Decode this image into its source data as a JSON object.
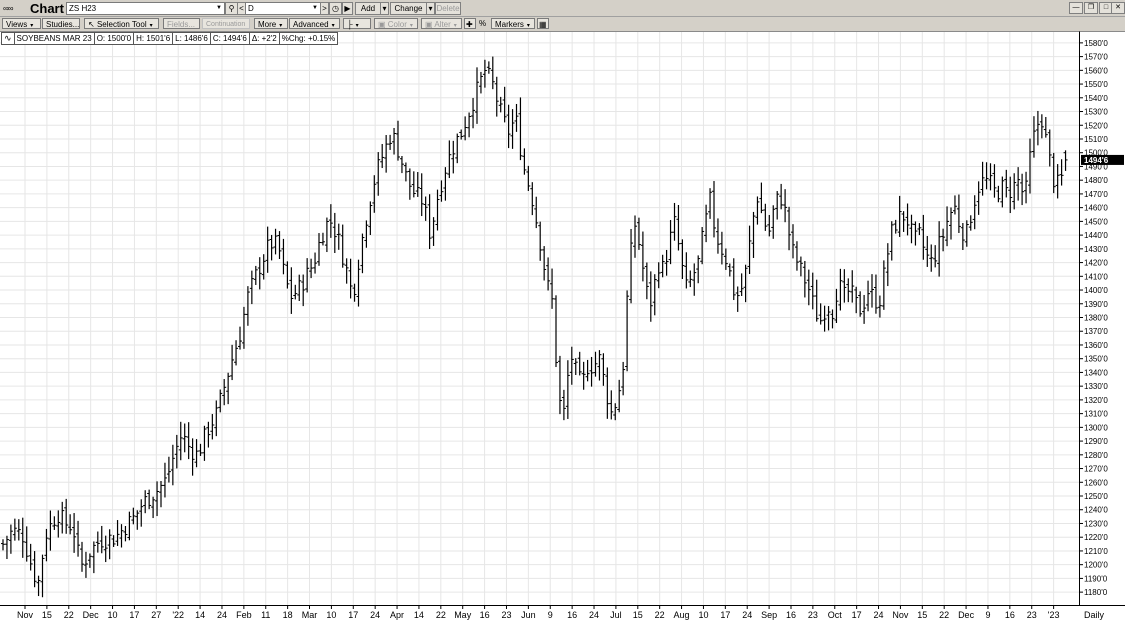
{
  "window": {
    "title": "Chart",
    "symbol_input": "ZS H23",
    "period_input": "D",
    "add_label": "Add",
    "change_label": "Change",
    "delete_label": "Delete"
  },
  "toolbar": {
    "views": "Views",
    "studies": "Studies...",
    "selection_tool": "Selection Tool",
    "fields": "Fields...",
    "continuation": "Continuation",
    "more": "More",
    "advanced": "Advanced",
    "color": "Color",
    "alter": "Alter",
    "percent": "%",
    "markers": "Markers"
  },
  "info": {
    "name": "SOYBEANS MAR 23",
    "open": "O: 1500'0",
    "high": "H: 1501'6",
    "low": "L: 1486'6",
    "close": "C: 1494'6",
    "delta": "Δ: +2'2",
    "pct": "%Chg: +0.15%"
  },
  "last_price_label": "1494'6",
  "period_label": "Daily",
  "colors": {
    "bars": "#000000",
    "grid": "#e6e6e6",
    "last_price_bg": "#000000"
  },
  "chart_data": {
    "type": "ohlc",
    "title": "SOYBEANS MAR 23",
    "grid": true,
    "ylim": [
      1175,
      1585
    ],
    "y_ticks": [
      "1180'0",
      "1190'0",
      "1200'0",
      "1210'0",
      "1220'0",
      "1230'0",
      "1240'0",
      "1250'0",
      "1260'0",
      "1270'0",
      "1280'0",
      "1290'0",
      "1300'0",
      "1310'0",
      "1320'0",
      "1330'0",
      "1340'0",
      "1350'0",
      "1360'0",
      "1370'0",
      "1380'0",
      "1390'0",
      "1400'0",
      "1410'0",
      "1420'0",
      "1430'0",
      "1440'0",
      "1450'0",
      "1460'0",
      "1470'0",
      "1480'0",
      "1490'0",
      "1500'0",
      "1510'0",
      "1520'0",
      "1530'0",
      "1540'0",
      "1550'0",
      "1560'0",
      "1570'0",
      "1580'0"
    ],
    "x_ticks": [
      "Nov",
      "15",
      "22",
      "Dec",
      "10",
      "17",
      "27",
      "'22",
      "14",
      "24",
      "Feb",
      "11",
      "18",
      "Mar",
      "10",
      "17",
      "24",
      "Apr",
      "14",
      "22",
      "May",
      "16",
      "23",
      "Jun",
      "9",
      "16",
      "24",
      "Jul",
      "15",
      "22",
      "Aug",
      "10",
      "17",
      "24",
      "Sep",
      "16",
      "23",
      "Oct",
      "17",
      "24",
      "Nov",
      "15",
      "22",
      "Dec",
      "9",
      "16",
      "23",
      "'23"
    ],
    "close_path": [
      [
        0,
        1215
      ],
      [
        5,
        1225
      ],
      [
        10,
        1222
      ],
      [
        15,
        1198
      ],
      [
        18,
        1185
      ],
      [
        22,
        1222
      ],
      [
        28,
        1238
      ],
      [
        32,
        1230
      ],
      [
        36,
        1228
      ],
      [
        40,
        1198
      ],
      [
        45,
        1210
      ],
      [
        50,
        1218
      ],
      [
        58,
        1220
      ],
      [
        63,
        1228
      ],
      [
        68,
        1235
      ],
      [
        72,
        1245
      ],
      [
        76,
        1250
      ],
      [
        80,
        1255
      ],
      [
        84,
        1262
      ],
      [
        88,
        1280
      ],
      [
        92,
        1295
      ],
      [
        96,
        1285
      ],
      [
        100,
        1280
      ],
      [
        106,
        1300
      ],
      [
        110,
        1310
      ],
      [
        114,
        1330
      ],
      [
        118,
        1350
      ],
      [
        122,
        1368
      ],
      [
        126,
        1395
      ],
      [
        130,
        1410
      ],
      [
        133,
        1420
      ],
      [
        136,
        1430
      ],
      [
        139,
        1435
      ],
      [
        142,
        1430
      ],
      [
        145,
        1410
      ],
      [
        148,
        1395
      ],
      [
        152,
        1400
      ],
      [
        156,
        1410
      ],
      [
        160,
        1420
      ],
      [
        164,
        1440
      ],
      [
        168,
        1452
      ],
      [
        172,
        1440
      ],
      [
        176,
        1420
      ],
      [
        180,
        1395
      ],
      [
        184,
        1430
      ],
      [
        188,
        1460
      ],
      [
        192,
        1485
      ],
      [
        196,
        1500
      ],
      [
        200,
        1515
      ],
      [
        204,
        1500
      ],
      [
        208,
        1480
      ],
      [
        212,
        1470
      ],
      [
        216,
        1465
      ],
      [
        220,
        1440
      ],
      [
        224,
        1470
      ],
      [
        228,
        1490
      ],
      [
        232,
        1505
      ],
      [
        236,
        1515
      ],
      [
        240,
        1530
      ],
      [
        244,
        1545
      ],
      [
        248,
        1560
      ],
      [
        252,
        1550
      ],
      [
        256,
        1530
      ],
      [
        260,
        1515
      ],
      [
        264,
        1525
      ],
      [
        268,
        1490
      ],
      [
        272,
        1470
      ],
      [
        276,
        1440
      ],
      [
        280,
        1405
      ],
      [
        283,
        1390
      ],
      [
        286,
        1320
      ],
      [
        289,
        1310
      ],
      [
        292,
        1355
      ],
      [
        295,
        1340
      ],
      [
        298,
        1330
      ],
      [
        301,
        1345
      ],
      [
        304,
        1345
      ],
      [
        307,
        1350
      ],
      [
        310,
        1330
      ],
      [
        313,
        1310
      ],
      [
        316,
        1320
      ],
      [
        319,
        1340
      ],
      [
        322,
        1410
      ],
      [
        325,
        1450
      ],
      [
        328,
        1430
      ],
      [
        331,
        1400
      ],
      [
        334,
        1390
      ],
      [
        337,
        1420
      ],
      [
        340,
        1415
      ],
      [
        343,
        1435
      ],
      [
        346,
        1450
      ],
      [
        349,
        1420
      ],
      [
        352,
        1400
      ],
      [
        355,
        1410
      ],
      [
        358,
        1420
      ],
      [
        361,
        1445
      ],
      [
        364,
        1465
      ],
      [
        367,
        1440
      ],
      [
        370,
        1430
      ],
      [
        373,
        1420
      ],
      [
        376,
        1400
      ],
      [
        379,
        1395
      ],
      [
        382,
        1410
      ],
      [
        385,
        1440
      ],
      [
        388,
        1470
      ],
      [
        391,
        1455
      ],
      [
        394,
        1440
      ],
      [
        397,
        1460
      ],
      [
        400,
        1470
      ],
      [
        403,
        1455
      ],
      [
        406,
        1430
      ],
      [
        409,
        1420
      ],
      [
        412,
        1410
      ],
      [
        415,
        1400
      ],
      [
        418,
        1385
      ],
      [
        421,
        1378
      ],
      [
        424,
        1390
      ],
      [
        427,
        1385
      ],
      [
        430,
        1405
      ],
      [
        433,
        1395
      ],
      [
        436,
        1400
      ],
      [
        439,
        1390
      ],
      [
        442,
        1385
      ],
      [
        445,
        1400
      ],
      [
        448,
        1395
      ],
      [
        451,
        1390
      ],
      [
        454,
        1415
      ],
      [
        457,
        1440
      ],
      [
        460,
        1450
      ],
      [
        463,
        1455
      ],
      [
        466,
        1450
      ],
      [
        469,
        1435
      ],
      [
        472,
        1440
      ],
      [
        475,
        1425
      ],
      [
        478,
        1420
      ],
      [
        481,
        1430
      ],
      [
        484,
        1440
      ],
      [
        487,
        1455
      ],
      [
        490,
        1460
      ],
      [
        493,
        1445
      ],
      [
        496,
        1440
      ],
      [
        499,
        1460
      ],
      [
        502,
        1475
      ],
      [
        505,
        1480
      ],
      [
        508,
        1478
      ],
      [
        511,
        1470
      ],
      [
        514,
        1475
      ],
      [
        517,
        1470
      ],
      [
        520,
        1475
      ],
      [
        523,
        1480
      ],
      [
        526,
        1465
      ],
      [
        529,
        1500
      ],
      [
        532,
        1520
      ],
      [
        535,
        1525
      ],
      [
        538,
        1500
      ],
      [
        541,
        1480
      ],
      [
        544,
        1475
      ],
      [
        547,
        1494.75
      ]
    ],
    "last": {
      "open": 1500.0,
      "high": 1501.75,
      "low": 1486.75,
      "close": 1494.75,
      "change": 2.25,
      "pct_change": 0.15
    }
  }
}
